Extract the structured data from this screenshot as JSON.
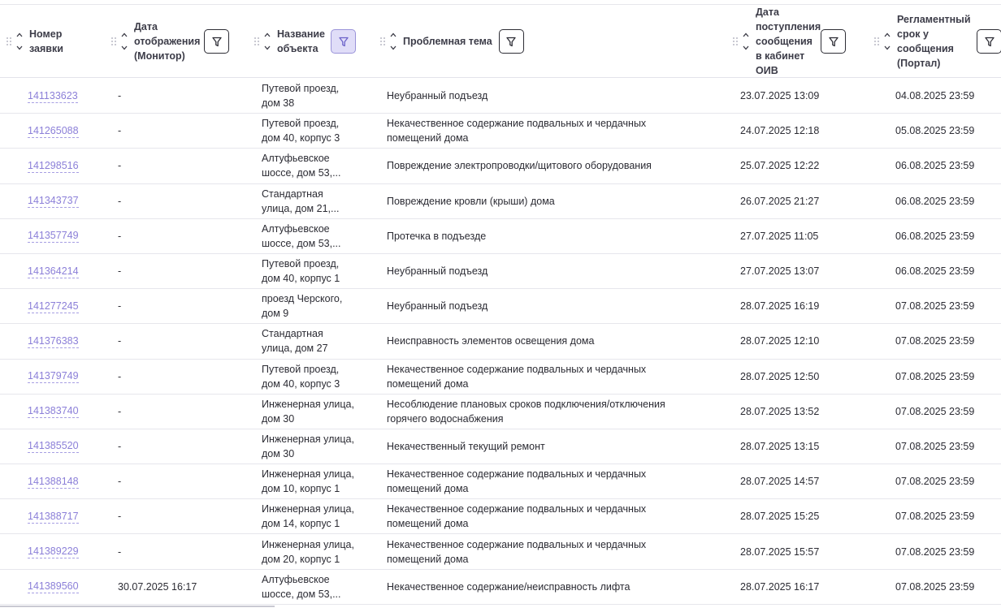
{
  "columns": [
    {
      "key": "number",
      "label": "Номер\nзаявки",
      "filter": false,
      "filter_active": false
    },
    {
      "key": "monitor",
      "label": "Дата\nотображения\n(Монитор)",
      "filter": true,
      "filter_active": false
    },
    {
      "key": "object",
      "label": "Название\nобъекта",
      "filter": true,
      "filter_active": true
    },
    {
      "key": "topic",
      "label": "Проблемная тема",
      "filter": true,
      "filter_active": false
    },
    {
      "key": "received",
      "label": "Дата\nпоступления\nсообщения\nв кабинет\nОИВ",
      "filter": true,
      "filter_active": false
    },
    {
      "key": "deadline",
      "label": "Регламентный\nсрок у\nсообщения\n(Портал)",
      "filter": true,
      "filter_active": false
    }
  ],
  "rows": [
    {
      "number": "141133623",
      "monitor": "-",
      "object": "Путевой проезд,\nдом 38",
      "topic": "Неубранный подъезд",
      "received": "23.07.2025 13:09",
      "deadline": "04.08.2025 23:59"
    },
    {
      "number": "141265088",
      "monitor": "-",
      "object": "Путевой проезд,\nдом 40, корпус 3",
      "topic": "Некачественное содержание подвальных и чердачных\nпомещений дома",
      "received": "24.07.2025 12:18",
      "deadline": "05.08.2025 23:59"
    },
    {
      "number": "141298516",
      "monitor": "-",
      "object": "Алтуфьевское\nшоссе, дом 53,...",
      "topic": "Повреждение электропроводки/щитового оборудования",
      "received": "25.07.2025 12:22",
      "deadline": "06.08.2025 23:59"
    },
    {
      "number": "141343737",
      "monitor": "-",
      "object": "Стандартная\nулица, дом 21,...",
      "topic": "Повреждение кровли (крыши) дома",
      "received": "26.07.2025 21:27",
      "deadline": "06.08.2025 23:59"
    },
    {
      "number": "141357749",
      "monitor": "-",
      "object": "Алтуфьевское\nшоссе, дом 53,...",
      "topic": "Протечка в подъезде",
      "received": "27.07.2025 11:05",
      "deadline": "06.08.2025 23:59"
    },
    {
      "number": "141364214",
      "monitor": "-",
      "object": "Путевой проезд,\nдом 40, корпус 1",
      "topic": "Неубранный подъезд",
      "received": "27.07.2025 13:07",
      "deadline": "06.08.2025 23:59"
    },
    {
      "number": "141277245",
      "monitor": "-",
      "object": "проезд Черского,\nдом 9",
      "topic": "Неубранный подъезд",
      "received": "28.07.2025 16:19",
      "deadline": "07.08.2025 23:59"
    },
    {
      "number": "141376383",
      "monitor": "-",
      "object": "Стандартная\nулица, дом 27",
      "topic": "Неисправность элементов освещения дома",
      "received": "28.07.2025 12:10",
      "deadline": "07.08.2025 23:59"
    },
    {
      "number": "141379749",
      "monitor": "-",
      "object": "Путевой проезд,\nдом 40, корпус 3",
      "topic": "Некачественное содержание подвальных и чердачных\nпомещений дома",
      "received": "28.07.2025 12:50",
      "deadline": "07.08.2025 23:59"
    },
    {
      "number": "141383740",
      "monitor": "-",
      "object": "Инженерная улица,\nдом 30",
      "topic": "Несоблюдение плановых сроков подключения/отключения\nгорячего водоснабжения",
      "received": "28.07.2025 13:52",
      "deadline": "07.08.2025 23:59"
    },
    {
      "number": "141385520",
      "monitor": "-",
      "object": "Инженерная улица,\nдом 30",
      "topic": "Некачественный текущий ремонт",
      "received": "28.07.2025 13:15",
      "deadline": "07.08.2025 23:59"
    },
    {
      "number": "141388148",
      "monitor": "-",
      "object": "Инженерная улица,\nдом 10, корпус 1",
      "topic": "Некачественное содержание подвальных и чердачных\nпомещений дома",
      "received": "28.07.2025 14:57",
      "deadline": "07.08.2025 23:59"
    },
    {
      "number": "141388717",
      "monitor": "-",
      "object": "Инженерная улица,\nдом 14, корпус 1",
      "topic": "Некачественное содержание подвальных и чердачных\nпомещений дома",
      "received": "28.07.2025 15:25",
      "deadline": "07.08.2025 23:59"
    },
    {
      "number": "141389229",
      "monitor": "-",
      "object": "Инженерная улица,\nдом 20, корпус 1",
      "topic": "Некачественное содержание подвальных и чердачных\nпомещений дома",
      "received": "28.07.2025 15:57",
      "deadline": "07.08.2025 23:59"
    },
    {
      "number": "141389560",
      "monitor": "30.07.2025 16:17",
      "object": "Алтуфьевское\nшоссе, дом 53,...",
      "topic": "Некачественное содержание/неисправность лифта",
      "received": "28.07.2025 16:17",
      "deadline": "07.08.2025 23:59"
    }
  ]
}
